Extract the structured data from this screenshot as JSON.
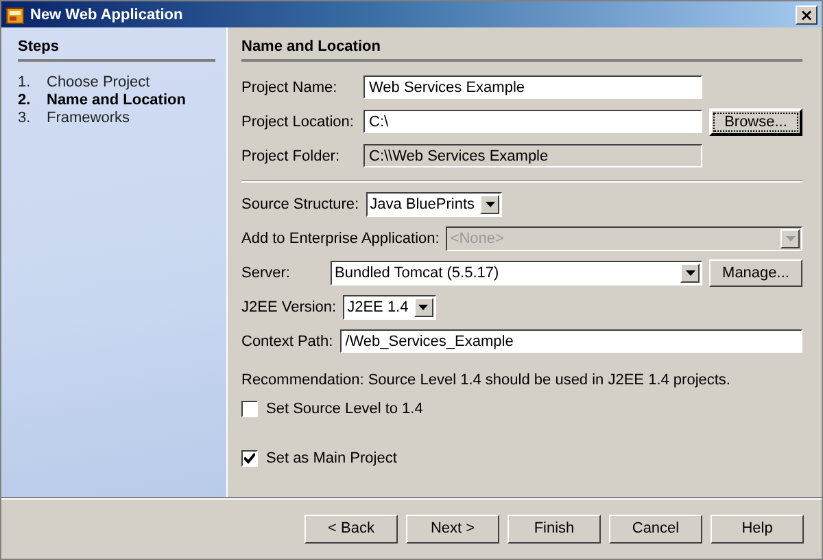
{
  "window": {
    "title": "New Web Application",
    "close": "×"
  },
  "steps": {
    "title": "Steps",
    "items": [
      {
        "number": "1.",
        "label": "Choose Project",
        "selected": false
      },
      {
        "number": "2.",
        "label": "Name and Location",
        "selected": true
      },
      {
        "number": "3.",
        "label": "Frameworks",
        "selected": false
      }
    ]
  },
  "panel": {
    "title": "Name and Location",
    "sections": [
      {
        "rows": [
          {
            "kind": "text",
            "label": "Project Name:",
            "value": "Web Services Example"
          },
          {
            "kind": "text",
            "label": "Project Location:",
            "value": "C:\\",
            "button": "Browse...",
            "focused": true
          },
          {
            "kind": "readonly",
            "label": "Project Folder:",
            "value": "C:\\\\Web Services Example"
          }
        ]
      },
      {
        "separator_before": true,
        "rows": [
          {
            "kind": "combo",
            "label": "Source Structure:",
            "value": "Java BluePrints",
            "disabled": false
          },
          {
            "kind": "combo",
            "label": "Add to Enterprise Application:",
            "value": "<None>",
            "disabled": true
          }
        ]
      },
      {
        "rows": [
          {
            "kind": "combo",
            "label": "Server:",
            "value": "Bundled Tomcat (5.5.17)",
            "button": "Manage...",
            "disabled": false
          },
          {
            "kind": "combo",
            "label": "J2EE Version:",
            "value": "J2EE 1.4",
            "disabled": false
          },
          {
            "kind": "text",
            "label": "Context Path:",
            "value": "/Web_Services_Example"
          },
          {
            "kind": "note",
            "label": "Recommendation: Source Level 1.4 should be used in J2EE 1.4 projects."
          },
          {
            "kind": "checkbox",
            "label": "Set Source Level to 1.4",
            "checked": false
          },
          {
            "kind": "spacer"
          },
          {
            "kind": "checkbox",
            "label": "Set as Main Project",
            "checked": true
          }
        ]
      }
    ]
  },
  "buttons": [
    "< Back",
    "Next >",
    "Finish",
    "Cancel",
    "Help"
  ]
}
